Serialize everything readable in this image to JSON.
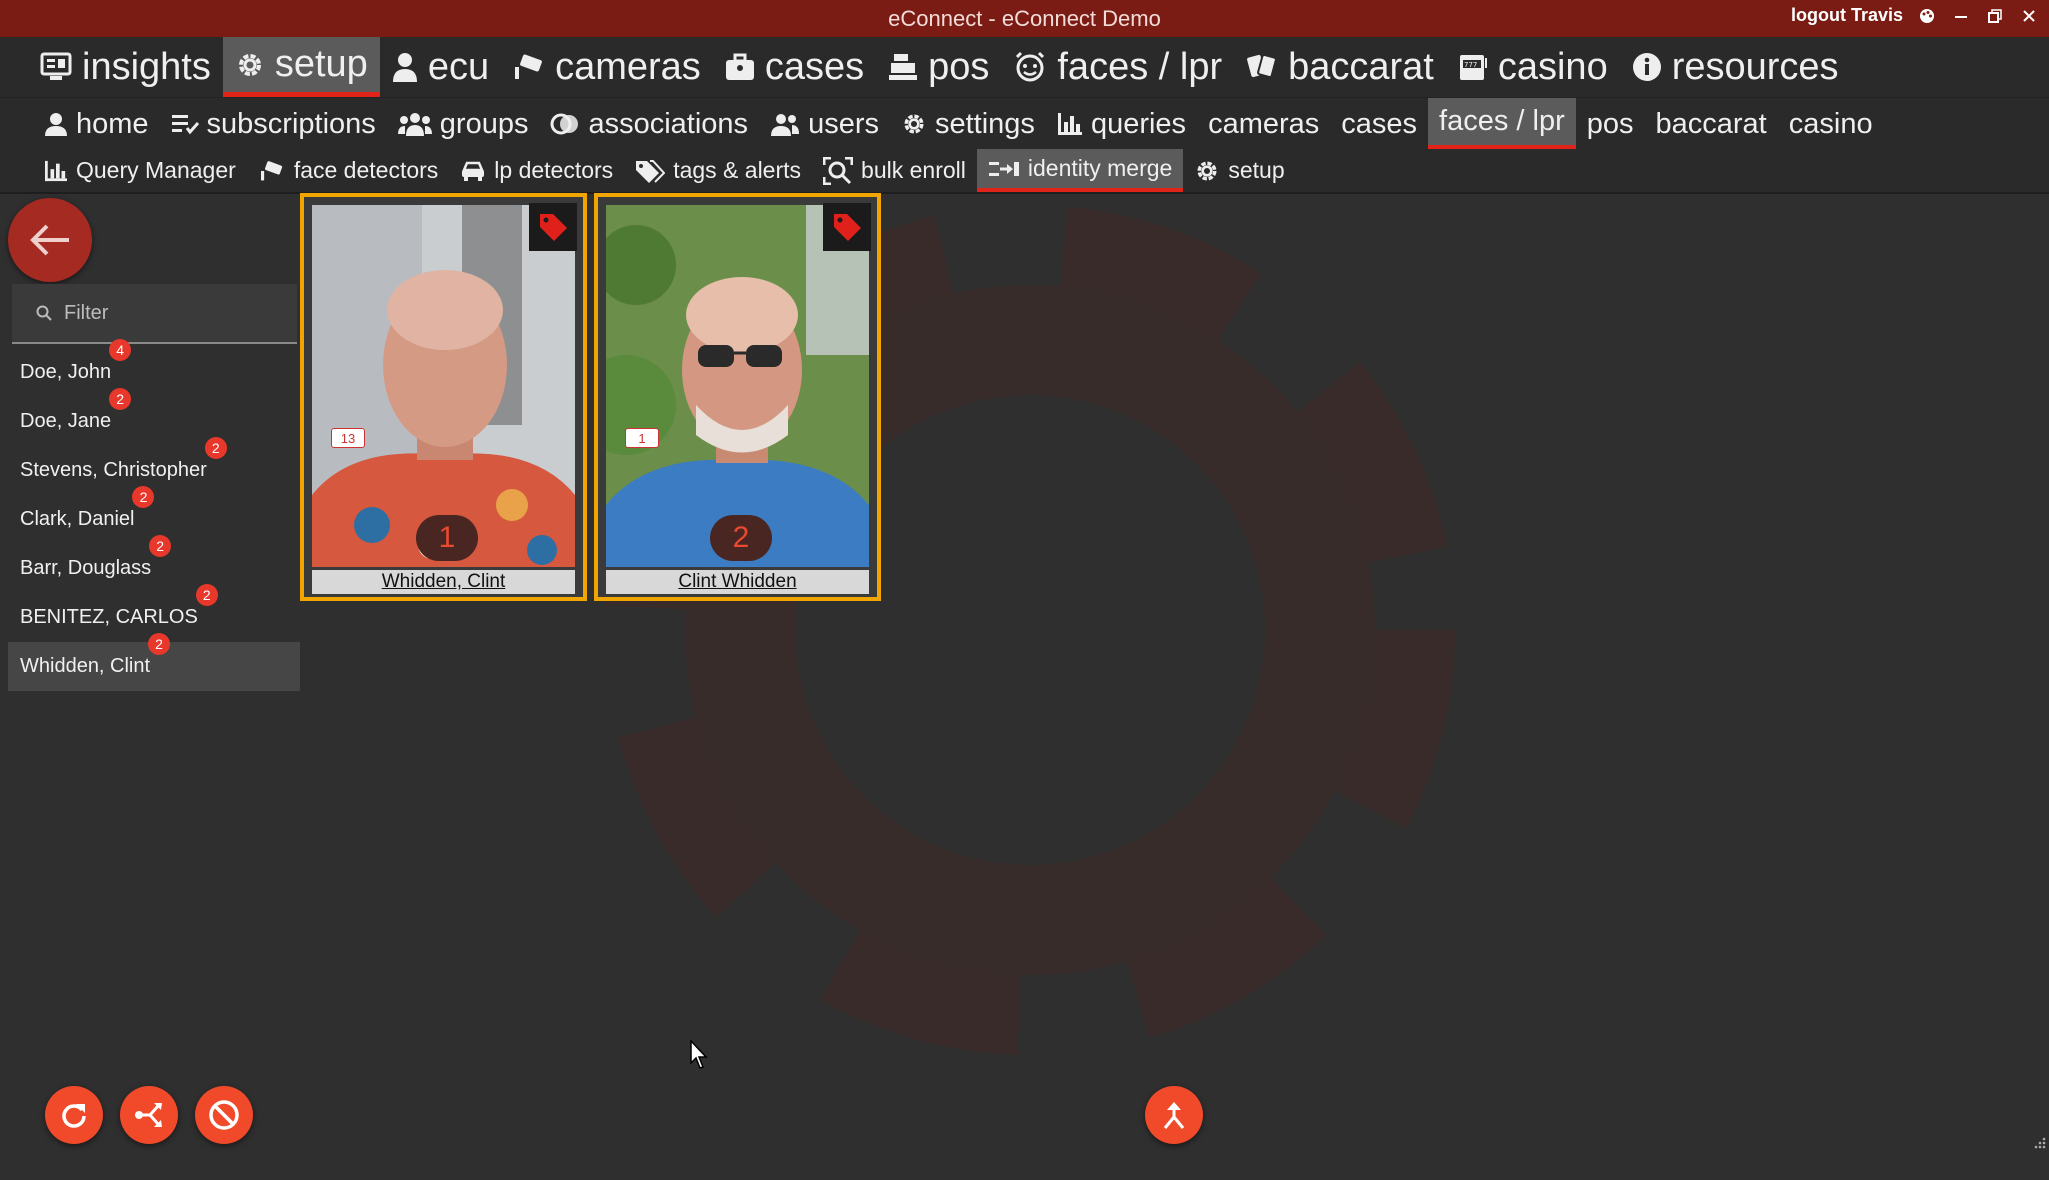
{
  "window": {
    "title": "eConnect - eConnect Demo",
    "logout_label": "logout Travis"
  },
  "nav_main": [
    {
      "label": "insights",
      "icon": "dashboard-icon"
    },
    {
      "label": "setup",
      "icon": "gear-icon",
      "active": true
    },
    {
      "label": "ecu",
      "icon": "user-tie-icon"
    },
    {
      "label": "cameras",
      "icon": "camera-icon"
    },
    {
      "label": "cases",
      "icon": "briefcase-icon"
    },
    {
      "label": "pos",
      "icon": "register-icon"
    },
    {
      "label": "faces / lpr",
      "icon": "face-scan-icon"
    },
    {
      "label": "baccarat",
      "icon": "cards-icon"
    },
    {
      "label": "casino",
      "icon": "slot-machine-icon"
    },
    {
      "label": "resources",
      "icon": "info-icon"
    }
  ],
  "nav_setup": [
    {
      "label": "home",
      "icon": "user-icon"
    },
    {
      "label": "subscriptions",
      "icon": "list-check-icon"
    },
    {
      "label": "groups",
      "icon": "users-group-icon"
    },
    {
      "label": "associations",
      "icon": "link-icon"
    },
    {
      "label": "users",
      "icon": "users-icon"
    },
    {
      "label": "settings",
      "icon": "gear-icon"
    },
    {
      "label": "queries",
      "icon": "bar-chart-icon"
    },
    {
      "label": "cameras"
    },
    {
      "label": "cases"
    },
    {
      "label": "faces / lpr",
      "active": true
    },
    {
      "label": "pos"
    },
    {
      "label": "baccarat"
    },
    {
      "label": "casino"
    }
  ],
  "nav_faces": [
    {
      "label": "Query Manager",
      "icon": "bar-chart-icon"
    },
    {
      "label": "face detectors",
      "icon": "camera-icon"
    },
    {
      "label": "lp detectors",
      "icon": "car-icon"
    },
    {
      "label": "tags & alerts",
      "icon": "tags-icon"
    },
    {
      "label": "bulk enroll",
      "icon": "scan-search-icon"
    },
    {
      "label": "identity merge",
      "icon": "merge-icon",
      "active": true
    },
    {
      "label": "setup",
      "icon": "gear-icon"
    }
  ],
  "filter": {
    "placeholder": "Filter",
    "value": ""
  },
  "identities": [
    {
      "name": "Doe, John",
      "count": "4"
    },
    {
      "name": "Doe, Jane",
      "count": "2"
    },
    {
      "name": "Stevens, Christopher",
      "count": "2"
    },
    {
      "name": "Clark, Daniel",
      "count": "2"
    },
    {
      "name": "Barr, Douglass",
      "count": "2"
    },
    {
      "name": "BENITEZ, CARLOS",
      "count": "2"
    },
    {
      "name": "Whidden, Clint",
      "count": "2",
      "selected": true
    }
  ],
  "cards": [
    {
      "name": "Whidden, Clint",
      "count": "13",
      "number": "1"
    },
    {
      "name": "Clint Whidden",
      "count": "1",
      "number": "2"
    }
  ],
  "colors": {
    "titlebar": "#7a1c14",
    "accent_red": "#e0241a",
    "card_border": "#f0a500",
    "fab": "#f04a2a"
  }
}
